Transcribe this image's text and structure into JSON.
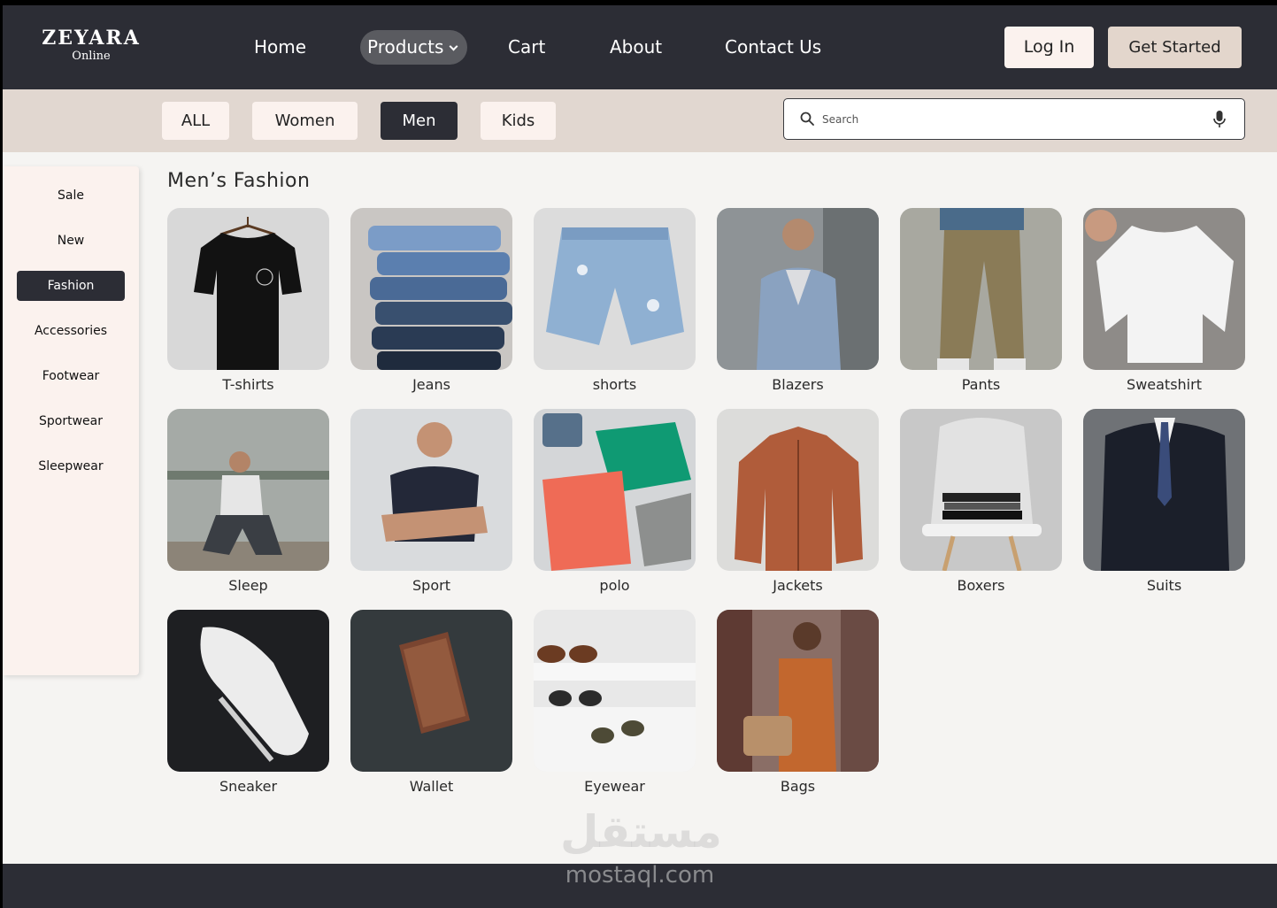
{
  "brand": {
    "name": "ZEYARA",
    "tagline": "Online"
  },
  "nav": {
    "home": "Home",
    "products": "Products",
    "cart": "Cart",
    "about": "About",
    "contact": "Contact Us",
    "login": "Log In",
    "get_started": "Get Started"
  },
  "filters": [
    "ALL",
    "Women",
    "Men",
    "Kids"
  ],
  "active_filter": "Men",
  "search": {
    "placeholder": "Search"
  },
  "sidebar": {
    "items": [
      "Sale",
      "New",
      "Fashion",
      "Accessories",
      "Footwear",
      "Sportwear",
      "Sleepwear"
    ],
    "active": "Fashion"
  },
  "section_title": "Men’s Fashion",
  "products": [
    "T-shirts",
    "Jeans",
    "shorts",
    "Blazers",
    "Pants",
    "Sweatshirt",
    "Sleep",
    "Sport",
    "polo",
    "Jackets",
    "Boxers",
    "Suits",
    "Sneaker",
    "Wallet",
    "Eyewear",
    "Bags"
  ],
  "watermark": {
    "arabic": "مستقل",
    "latin": "mostaql.com"
  },
  "colors": {
    "dark": "#2c2d35",
    "beige": "#e1d7d0",
    "cream": "#fbf2ee",
    "page": "#f5f4f2"
  }
}
